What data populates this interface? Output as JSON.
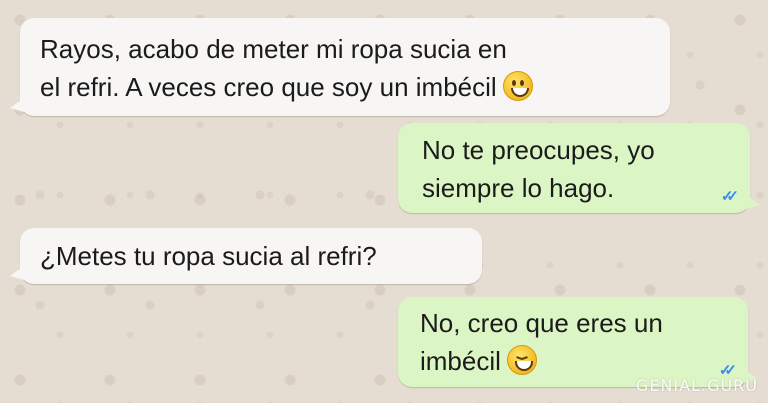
{
  "messages": [
    {
      "direction": "incoming",
      "text": "Rayos, acabo de meter mi ropa sucia en\nel refri. A veces creo que soy un imbécil",
      "emoji": "grinning-face-icon"
    },
    {
      "direction": "outgoing",
      "text": "No te preocupes, yo\nsiempre lo hago.",
      "status": "read-double-check"
    },
    {
      "direction": "incoming",
      "text": "¿Metes tu ropa sucia al refri?"
    },
    {
      "direction": "outgoing",
      "text": "No, creo que eres un\nimbécil",
      "emoji": "squinting-laughing-face-icon",
      "status": "read-double-check"
    }
  ],
  "watermark": "GENIAL.GURU",
  "colors": {
    "background": "#e6ddd2",
    "incoming_bubble": "#f7f6f4",
    "outgoing_bubble": "#dcf5c4",
    "read_ticks": "#3a8de8"
  }
}
